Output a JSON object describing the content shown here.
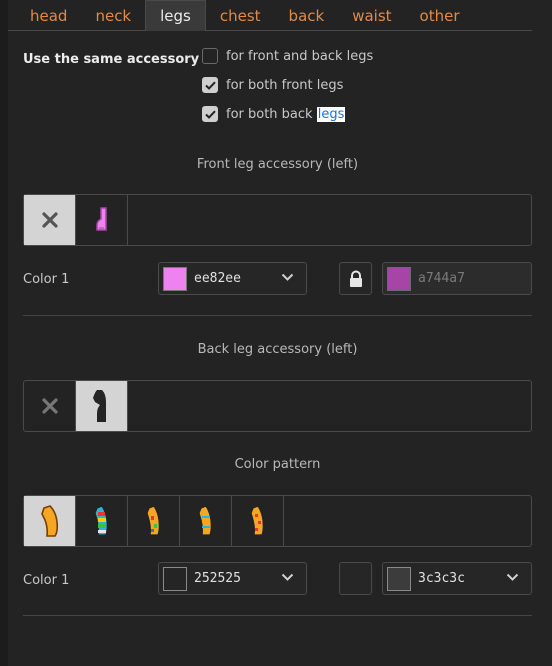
{
  "tabs": [
    {
      "label": "head",
      "active": false
    },
    {
      "label": "neck",
      "active": false
    },
    {
      "label": "legs",
      "active": true
    },
    {
      "label": "chest",
      "active": false
    },
    {
      "label": "back",
      "active": false
    },
    {
      "label": "waist",
      "active": false
    },
    {
      "label": "other",
      "active": false
    }
  ],
  "sync": {
    "label": "Use the same accessory",
    "options": [
      {
        "label": "for front and back legs",
        "checked": false
      },
      {
        "label": "for both front legs",
        "checked": true
      },
      {
        "label_prefix": "for both back ",
        "label_highlight": "legs",
        "checked": true
      }
    ]
  },
  "front": {
    "title": "Front leg accessory (left)",
    "items": [
      "none-icon",
      "leg-accessory-sock-icon"
    ],
    "selected_index": 0,
    "color1_label": "Color 1",
    "color1": {
      "hex": "ee82ee",
      "swatch": "#ee82ee"
    },
    "locked_color": {
      "hex": "a744a7",
      "swatch": "#a744a7"
    }
  },
  "back": {
    "title": "Back leg accessory (left)",
    "items": [
      "none-icon",
      "leg-accessory-boot-icon"
    ],
    "selected_index": 1
  },
  "pattern": {
    "title": "Color pattern",
    "items": [
      "pattern-plain-icon",
      "pattern-rainbow-icon",
      "pattern-mixed-icon",
      "pattern-striped-icon",
      "pattern-spotted-icon"
    ],
    "selected_index": 0,
    "color1_label": "Color 1",
    "color1": {
      "hex": "252525",
      "swatch": "#252525"
    },
    "color2": {
      "hex": "3c3c3c",
      "swatch": "#3c3c3c"
    }
  }
}
